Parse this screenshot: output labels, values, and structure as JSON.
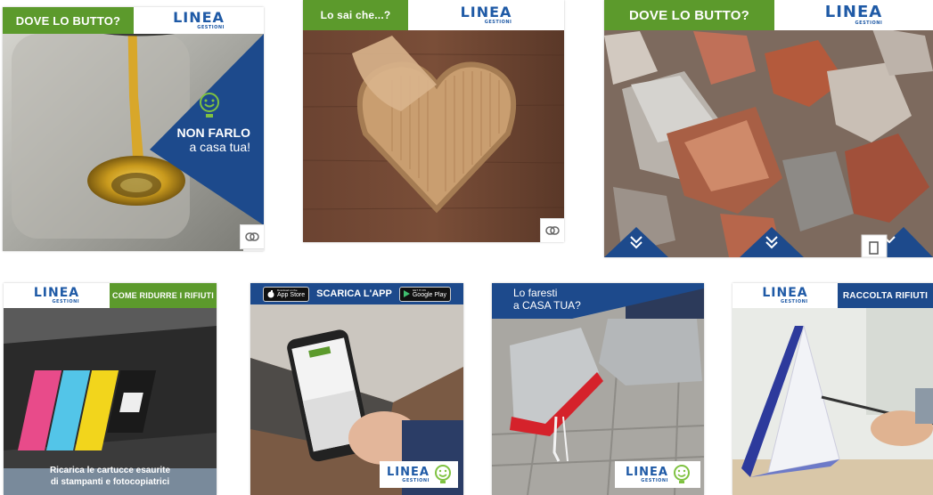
{
  "tiles": [
    {
      "tag": "DOVE LO BUTTO?",
      "logo": "LINEA",
      "logo_sub": "GESTIONI",
      "overlay_line1": "NON FARLO",
      "overlay_line2": "a casa tua!",
      "icon": "link-icon"
    },
    {
      "tag": "Lo sai che...?",
      "logo": "LINEA",
      "logo_sub": "GESTIONI",
      "icon": "link-icon"
    },
    {
      "tag": "DOVE LO BUTTO?",
      "logo": "LINEA",
      "logo_sub": "GESTIONI"
    },
    {
      "tag": "COME RIDURRE I RIFIUTI",
      "logo": "LINEA",
      "logo_sub": "GESTIONI",
      "caption_line1": "Ricarica le cartucce esaurite",
      "caption_line2": "di stampanti e fotocopiatrici"
    },
    {
      "tag": "SCARICA L'APP",
      "app_store": "App Store",
      "app_store_small": "Download on the",
      "google_play": "Google Play",
      "google_play_small": "GET IT ON",
      "logo": "LINEA",
      "logo_sub": "GESTIONI"
    },
    {
      "line1": "Lo faresti",
      "line2": "a CASA TUA?",
      "logo": "LINEA",
      "logo_sub": "GESTIONI"
    },
    {
      "tag": "RACCOLTA RIFIUTI",
      "logo": "LINEA",
      "logo_sub": "GESTIONI"
    }
  ],
  "colors": {
    "green": "#5c9a2c",
    "blue": "#1d4a8c"
  }
}
